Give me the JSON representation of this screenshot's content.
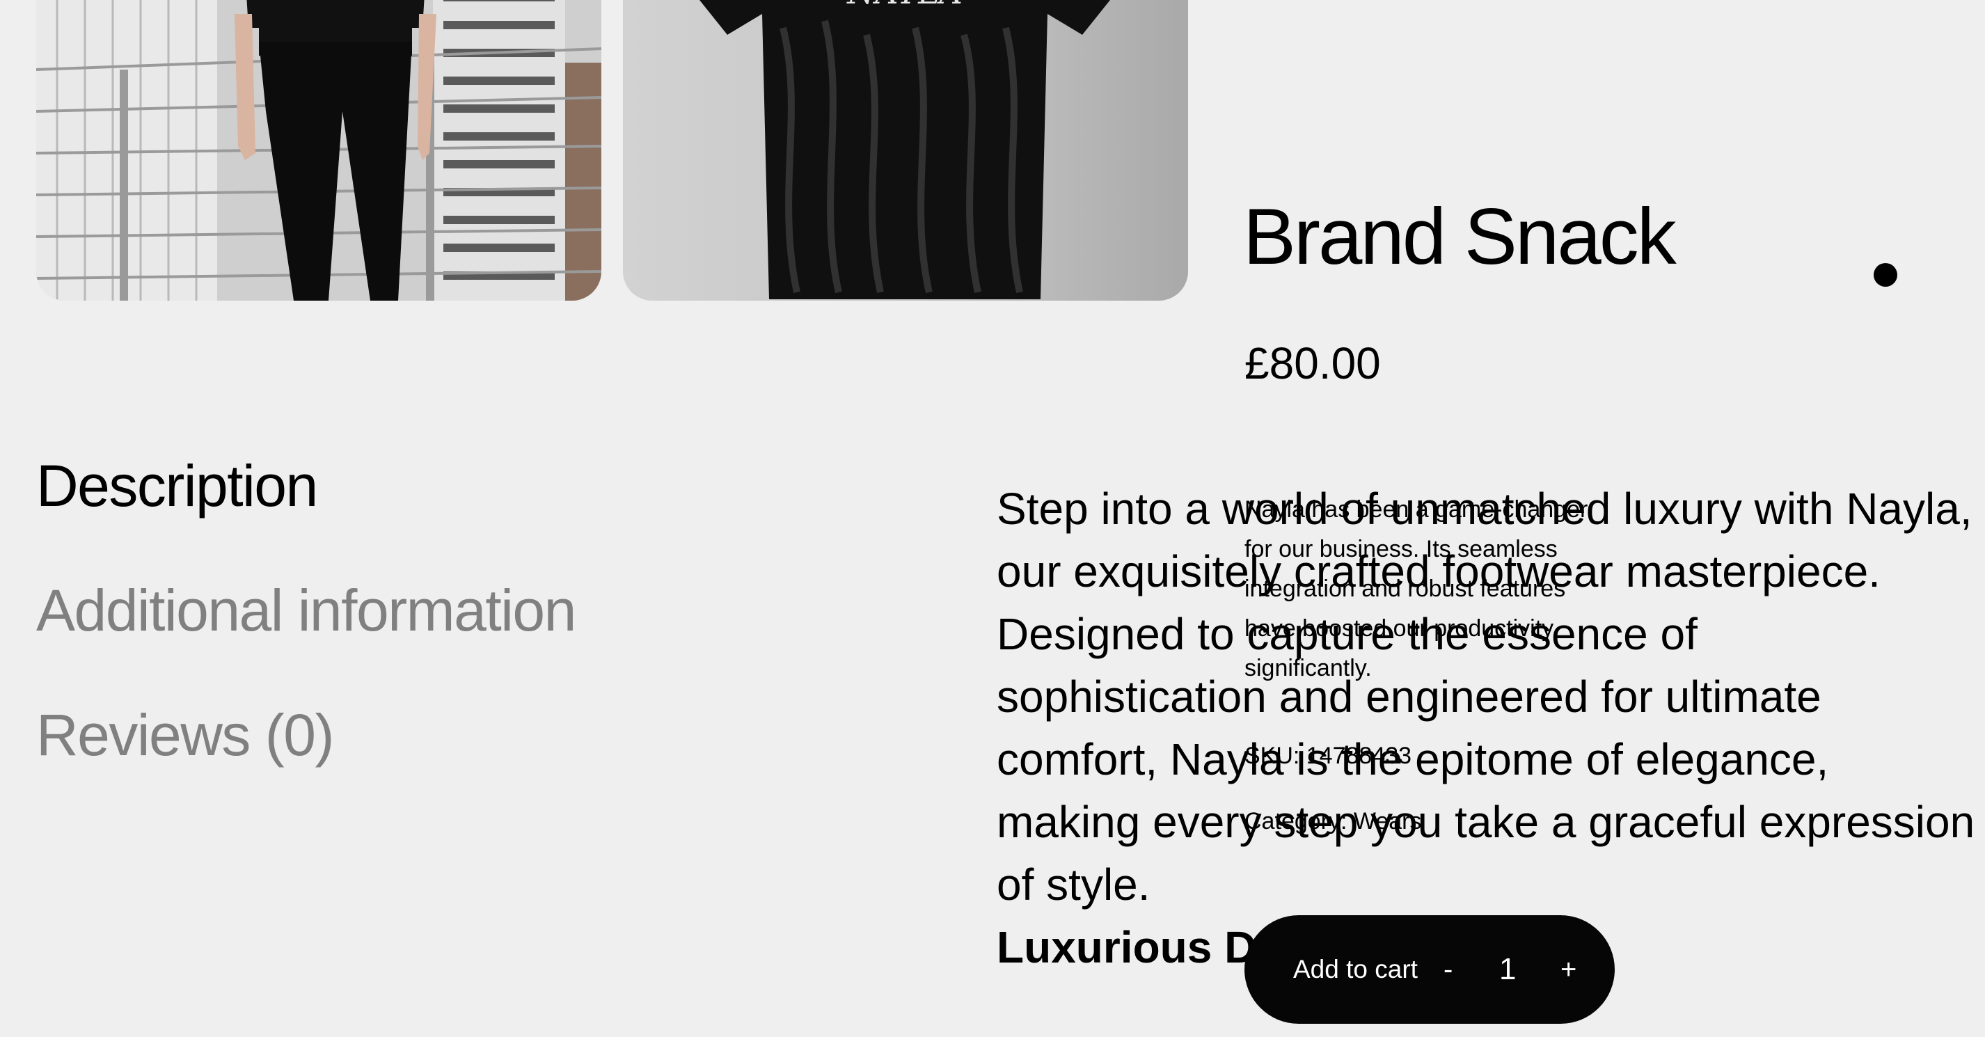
{
  "product": {
    "title": "Brand Snack",
    "price": "£80.00",
    "tshirt_print": "NAYLA",
    "short_description": "Nayla has been a game-changer for our business. Its seamless integration and robust features have boosted our productivity significantly.",
    "sku": "SKU: 14788433",
    "category": "Category: Wears"
  },
  "tabs": [
    {
      "label": "Description"
    },
    {
      "label": "Additional information"
    },
    {
      "label": "Reviews (0)"
    }
  ],
  "description": {
    "text": "Step into a world of unmatched luxury with Nayla, our exquisitely crafted footwear masterpiece. Designed to capture the essence of sophistication and engineered for ultimate comfort, Nayla is the epitome of elegance, making every step you take a graceful expression of style.",
    "heading": "Luxurious De"
  },
  "cart": {
    "add_label": "Add to cart",
    "minus": "-",
    "quantity": "1",
    "plus": "+"
  },
  "colors": {
    "background": "#efefef",
    "button": "#060606",
    "muted_tab": "#808080"
  }
}
